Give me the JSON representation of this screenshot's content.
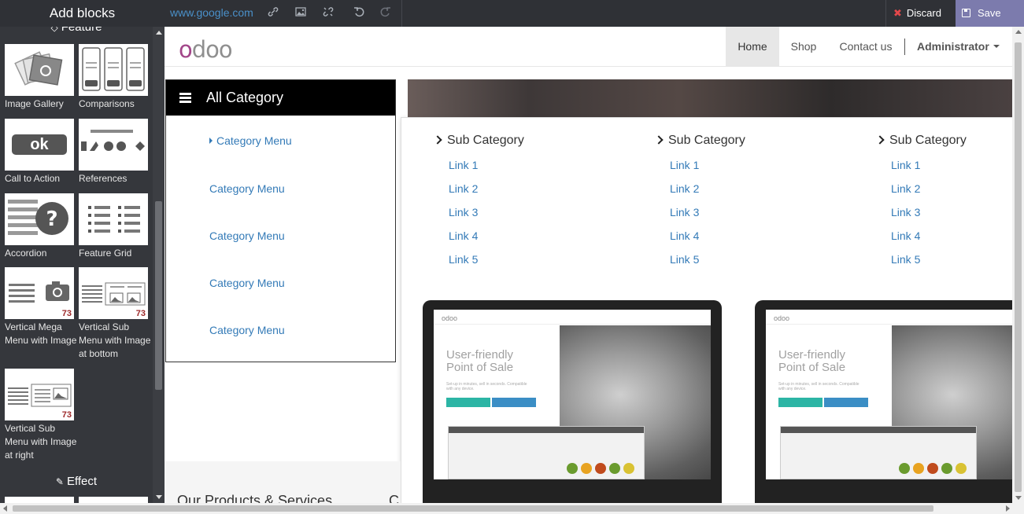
{
  "editor": {
    "panel_title": "Add blocks",
    "url": "www.google.com",
    "discard_label": "Discard",
    "save_label": "Save",
    "toolbar_icons": [
      "link-icon",
      "image-icon",
      "unlink-icon",
      "undo-icon",
      "redo-icon"
    ]
  },
  "snippets": {
    "section_feature": "Feature",
    "section_effect": "Effect",
    "items": [
      {
        "label": "Image Gallery",
        "icon": "image-gallery-thumb",
        "badge": ""
      },
      {
        "label": "Comparisons",
        "icon": "comparisons-thumb",
        "badge": ""
      },
      {
        "label": "Call to Action",
        "icon": "call-to-action-thumb",
        "badge": ""
      },
      {
        "label": "References",
        "icon": "references-thumb",
        "badge": ""
      },
      {
        "label": "Accordion",
        "icon": "accordion-thumb",
        "badge": ""
      },
      {
        "label": "Feature Grid",
        "icon": "feature-grid-thumb",
        "badge": ""
      },
      {
        "label": "Vertical Mega Menu with Image",
        "icon": "vertical-mega-menu-thumb",
        "badge": "73"
      },
      {
        "label": "Vertical Sub Menu with Image at bottom",
        "icon": "vertical-sub-menu-bottom-thumb",
        "badge": "73"
      },
      {
        "label": "Vertical Sub Menu with Image at right",
        "icon": "vertical-sub-menu-right-thumb",
        "badge": "73"
      }
    ],
    "cta_thumb_text": "ok"
  },
  "site": {
    "nav": {
      "home": "Home",
      "shop": "Shop",
      "contact": "Contact us",
      "user": "Administrator"
    },
    "all_category": "All Category",
    "categories": [
      "Category Menu",
      "Category Menu",
      "Category Menu",
      "Category Menu",
      "Category Menu"
    ],
    "sub_columns": [
      {
        "title": "Sub Category",
        "links": [
          "Link 1",
          "Link 2",
          "Link 3",
          "Link 4",
          "Link 5"
        ]
      },
      {
        "title": "Sub Category",
        "links": [
          "Link 1",
          "Link 2",
          "Link 3",
          "Link 4",
          "Link 5"
        ]
      },
      {
        "title": "Sub Category",
        "links": [
          "Link 1",
          "Link 2",
          "Link 3",
          "Link 4",
          "Link 5"
        ]
      }
    ],
    "laptop_screen": {
      "logo": "odoo",
      "headline_1": "User-friendly",
      "headline_2": "Point of Sale",
      "sub": "Set-up in minutes, sell in seconds. Compatible with any device."
    },
    "products_heading": "Our Products & Services",
    "products_heading_cut": "C"
  }
}
